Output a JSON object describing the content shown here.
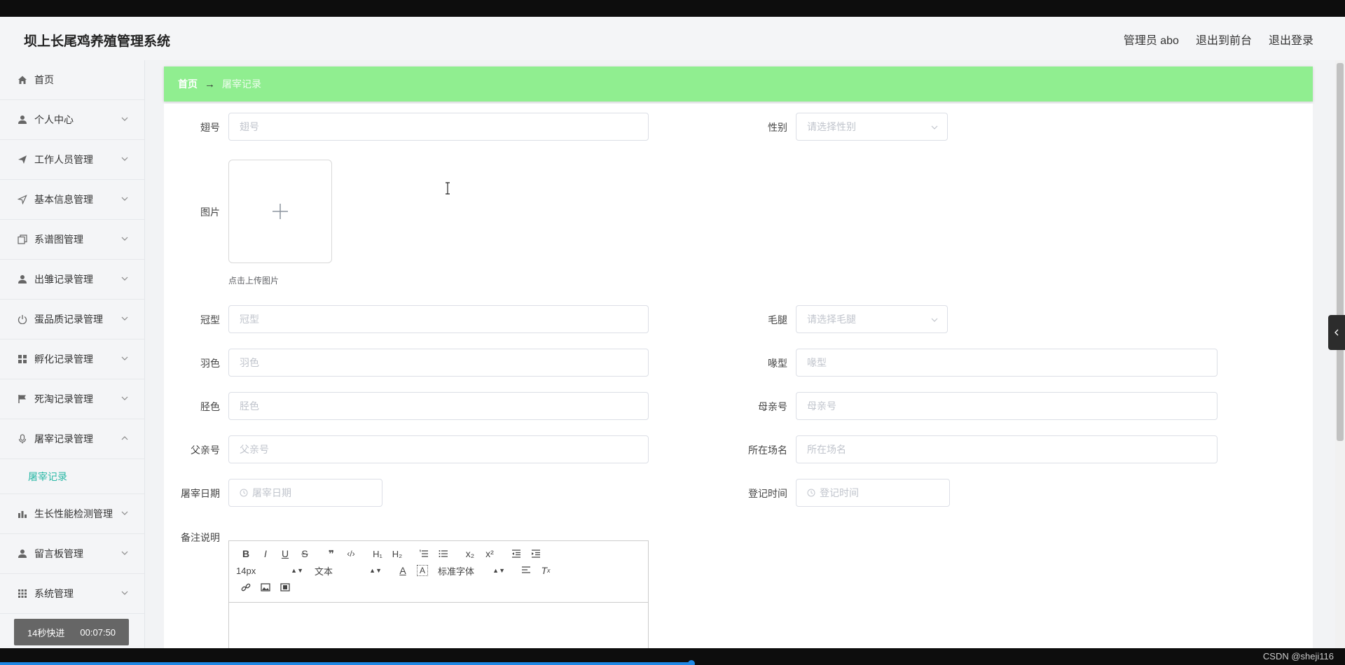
{
  "app": {
    "title": "坝上长尾鸡养殖管理系统",
    "user": "管理员 abo",
    "exit_front": "退出到前台",
    "logout": "退出登录"
  },
  "sidebar": {
    "items": [
      {
        "label": "首页",
        "icon": "home-icon"
      },
      {
        "label": "个人中心",
        "icon": "user-icon"
      },
      {
        "label": "工作人员管理",
        "icon": "send-icon"
      },
      {
        "label": "基本信息管理",
        "icon": "navigation-icon"
      },
      {
        "label": "系谱图管理",
        "icon": "copy-icon"
      },
      {
        "label": "出雏记录管理",
        "icon": "user-icon"
      },
      {
        "label": "蛋品质记录管理",
        "icon": "power-icon"
      },
      {
        "label": "孵化记录管理",
        "icon": "grid-icon"
      },
      {
        "label": "死淘记录管理",
        "icon": "flag-icon"
      },
      {
        "label": "屠宰记录管理",
        "icon": "mic-icon"
      },
      {
        "label": "生长性能检测管理",
        "icon": "chart-icon"
      },
      {
        "label": "留言板管理",
        "icon": "user-icon"
      },
      {
        "label": "系统管理",
        "icon": "apps-icon"
      }
    ],
    "submenu_active": "屠宰记录",
    "timer": {
      "speed": "14秒快进",
      "time": "00:07:50"
    }
  },
  "breadcrumb": {
    "home": "首页",
    "arrow": "→",
    "current": "屠宰记录"
  },
  "form": {
    "wing_no": {
      "label": "翅号",
      "placeholder": "翅号"
    },
    "gender": {
      "label": "性别",
      "placeholder": "请选择性别"
    },
    "image": {
      "label": "图片",
      "tip": "点击上传图片"
    },
    "comb": {
      "label": "冠型",
      "placeholder": "冠型"
    },
    "shank_feather": {
      "label": "毛腿",
      "placeholder": "请选择毛腿"
    },
    "plumage": {
      "label": "羽色",
      "placeholder": "羽色"
    },
    "beak": {
      "label": "喙型",
      "placeholder": "喙型"
    },
    "shank_color": {
      "label": "胫色",
      "placeholder": "胫色"
    },
    "mother_no": {
      "label": "母亲号",
      "placeholder": "母亲号"
    },
    "father_no": {
      "label": "父亲号",
      "placeholder": "父亲号"
    },
    "farm": {
      "label": "所在场名",
      "placeholder": "所在场名"
    },
    "slaughter_date": {
      "label": "屠宰日期",
      "placeholder": "屠宰日期"
    },
    "register_time": {
      "label": "登记时间",
      "placeholder": "登记时间"
    },
    "remark": {
      "label": "备注说明"
    }
  },
  "editor": {
    "font_size": "14px",
    "format": "文本",
    "font": "标准字体"
  },
  "watermark": "CSDN @sheji116",
  "colors": {
    "breadcrumb_bg": "#90ee90",
    "active_submenu": "#2bb8a6"
  }
}
